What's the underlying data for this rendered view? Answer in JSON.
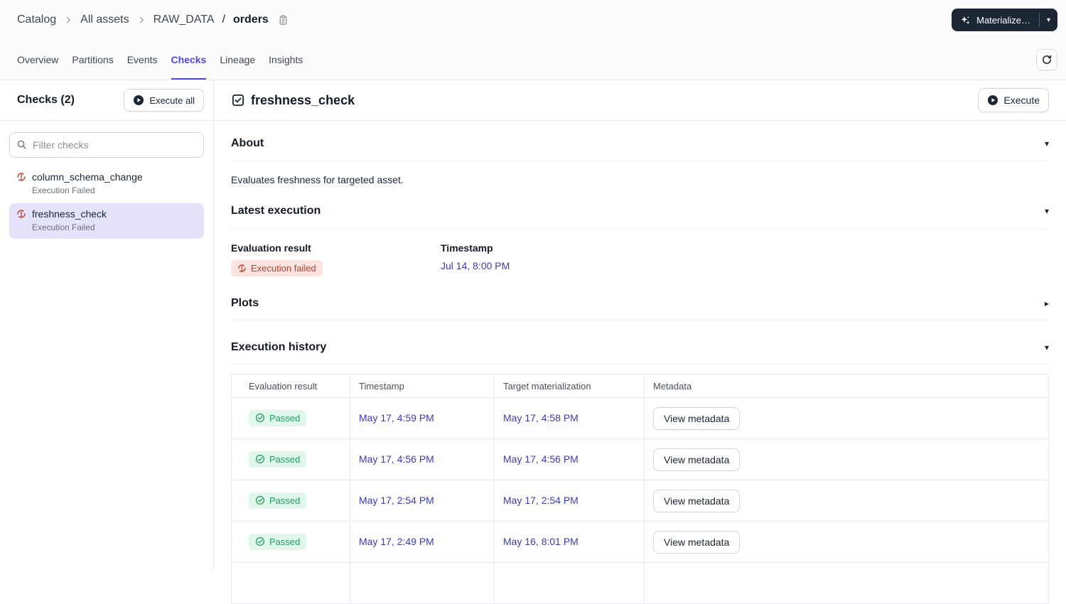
{
  "colors": {
    "accent": "#5149d6",
    "link": "#3b3ab0",
    "dark_button_bg": "#1c2634",
    "selected_bg": "#e5e3fb",
    "failed_bg": "#fbe3e0",
    "failed_text": "#b8422f",
    "passed_bg": "#e2f7eb",
    "passed_text": "#259d61"
  },
  "icons": {
    "caret_down": "▾",
    "caret_right": "▸"
  },
  "breadcrumb": {
    "catalog": "Catalog",
    "all_assets": "All assets",
    "asset_prefix": "RAW_DATA",
    "slash": "/",
    "asset_name": "orders"
  },
  "materialize_button": {
    "label": "Materialize…"
  },
  "tabs": [
    {
      "label": "Overview"
    },
    {
      "label": "Partitions"
    },
    {
      "label": "Events"
    },
    {
      "label": "Checks"
    },
    {
      "label": "Lineage"
    },
    {
      "label": "Insights"
    }
  ],
  "sidebar": {
    "title": "Checks (2)",
    "execute_all_label": "Execute all",
    "filter_placeholder": "Filter checks",
    "items": [
      {
        "name": "column_schema_change",
        "status": "Execution Failed"
      },
      {
        "name": "freshness_check",
        "status": "Execution Failed"
      }
    ]
  },
  "main": {
    "title": "freshness_check",
    "execute_label": "Execute",
    "about": {
      "title": "About",
      "description": "Evaluates freshness for targeted asset."
    },
    "latest_execution": {
      "title": "Latest execution",
      "evaluation_result_label": "Evaluation result",
      "evaluation_result_value": "Execution failed",
      "timestamp_label": "Timestamp",
      "timestamp_value": "Jul 14, 8:00 PM"
    },
    "plots": {
      "title": "Plots"
    },
    "execution_history": {
      "title": "Execution history",
      "columns": [
        "Evaluation result",
        "Timestamp",
        "Target materialization",
        "Metadata"
      ],
      "rows": [
        {
          "result": "Passed",
          "timestamp": "May 17, 4:59 PM",
          "target_materialization": "May 17, 4:58 PM",
          "metadata_button": "View metadata"
        },
        {
          "result": "Passed",
          "timestamp": "May 17, 4:56 PM",
          "target_materialization": "May 17, 4:56 PM",
          "metadata_button": "View metadata"
        },
        {
          "result": "Passed",
          "timestamp": "May 17, 2:54 PM",
          "target_materialization": "May 17, 2:54 PM",
          "metadata_button": "View metadata"
        },
        {
          "result": "Passed",
          "timestamp": "May 17, 2:49 PM",
          "target_materialization": "May 16, 8:01 PM",
          "metadata_button": "View metadata"
        }
      ]
    }
  }
}
